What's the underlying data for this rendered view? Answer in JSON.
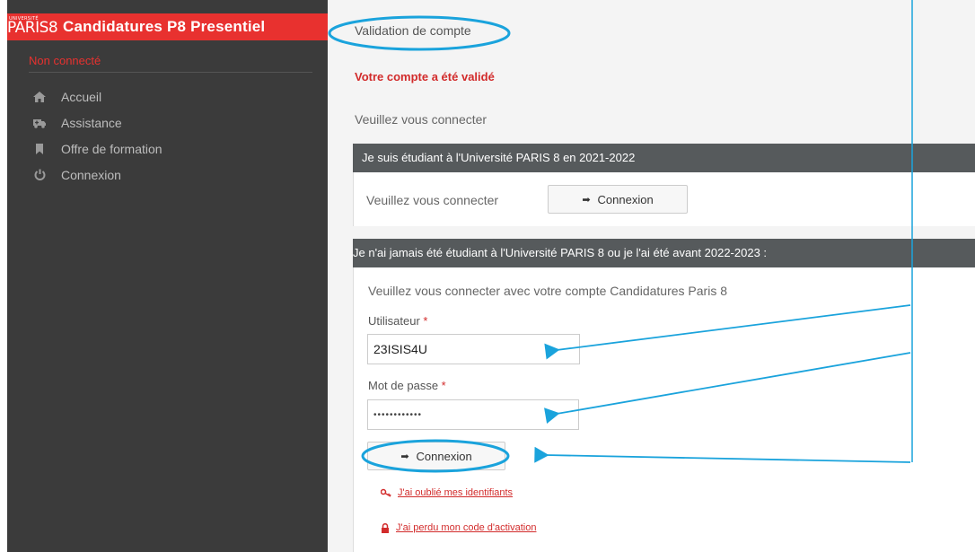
{
  "brand": {
    "logo_small": "UNIVERSITÉ",
    "logo_text": "PARIS8",
    "title": "Candidatures P8 Presentiel"
  },
  "sidebar": {
    "status": "Non connecté",
    "items": [
      {
        "label": "Accueil",
        "icon": "home-icon"
      },
      {
        "label": "Assistance",
        "icon": "ambulance-icon"
      },
      {
        "label": "Offre de formation",
        "icon": "bookmark-icon"
      },
      {
        "label": "Connexion",
        "icon": "power-icon"
      }
    ]
  },
  "main": {
    "page_title": "Validation de compte",
    "success_message": "Votre compte a été validé",
    "hint": "Veuillez vous connecter",
    "panel_student": {
      "heading": "Je suis étudiant à l'Université PARIS 8 en 2021-2022",
      "text": "Veuillez vous connecter",
      "button": "Connexion"
    },
    "panel_new": {
      "heading": "Je n'ai jamais été étudiant à l'Université PARIS 8 ou je l'ai été avant 2022-2023 :",
      "intro": "Veuillez vous connecter avec votre compte Candidatures Paris 8",
      "user_label": "Utilisateur",
      "user_value": "23ISIS4U",
      "password_label": "Mot de passe",
      "password_value": "••••••••••••",
      "required_mark": "*",
      "button": "Connexion",
      "forgot_link": "J'ai oublié mes identifiants",
      "lost_code_link": "J'ai perdu mon code d'activation"
    }
  },
  "colors": {
    "brand_red": "#e8312f",
    "sidebar_bg": "#3b3b3b",
    "panel_head": "#565a5c",
    "annotation_blue": "#1aa3dc"
  }
}
